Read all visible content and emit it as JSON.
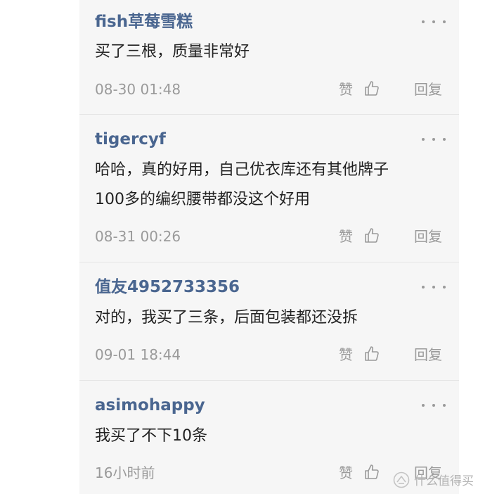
{
  "comments": [
    {
      "username": "fish草莓雪糕",
      "lines": [
        "买了三根，质量非常好"
      ],
      "time": "08-30 01:48",
      "like_label": "赞",
      "reply_label": "回复"
    },
    {
      "username": "tigercyf",
      "lines": [
        "哈哈，真的好用，自己优衣库还有其他牌子",
        "100多的编织腰带都没这个好用"
      ],
      "time": "08-31 00:26",
      "like_label": "赞",
      "reply_label": "回复"
    },
    {
      "username": "值友4952733356",
      "lines": [
        "对的，我买了三条，后面包装都还没拆"
      ],
      "time": "09-01 18:44",
      "like_label": "赞",
      "reply_label": "回复"
    },
    {
      "username": "asimohappy",
      "lines": [
        "我买了不下10条"
      ],
      "time": "16小时前",
      "like_label": "赞",
      "reply_label": "回复"
    }
  ],
  "watermark": {
    "text": "什么值得买",
    "icon": "smzdm-logo-icon"
  },
  "icons": {
    "more": "more-dots-icon",
    "like": "thumbs-up-icon"
  },
  "colors": {
    "username": "#4a6690",
    "text": "#222222",
    "meta": "#9a9a9a",
    "panel_background": "#f6f6f6"
  }
}
